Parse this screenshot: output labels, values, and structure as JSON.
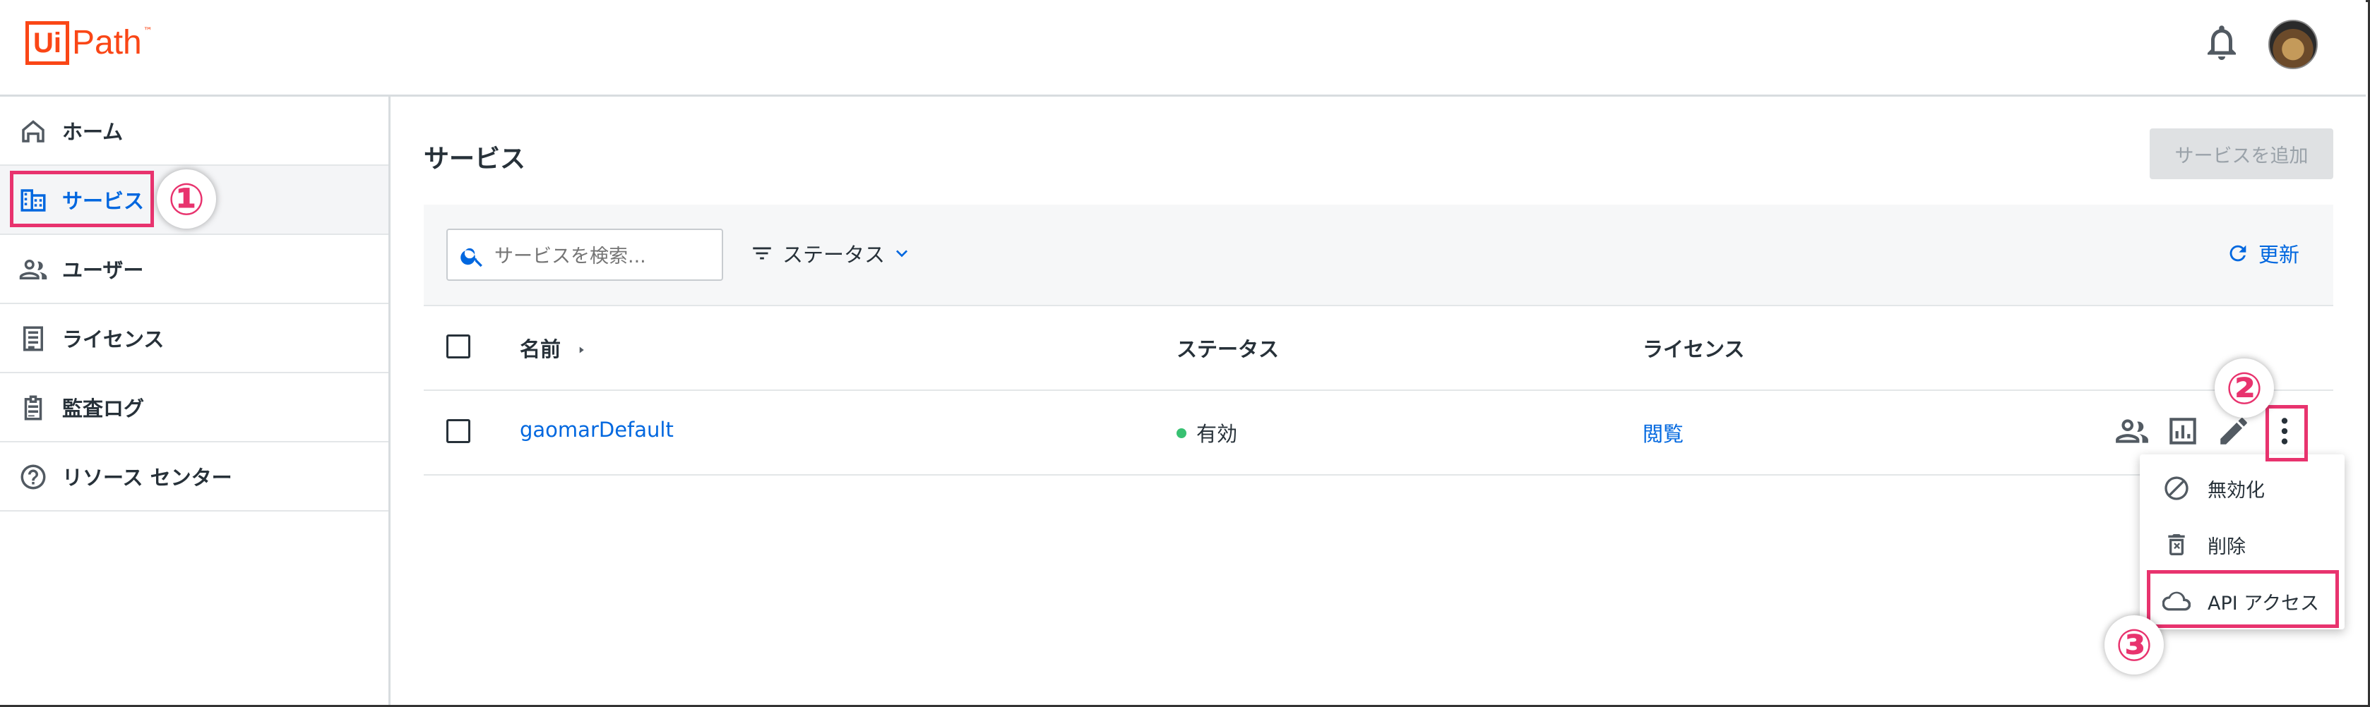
{
  "app": {
    "logo_ui": "Ui",
    "logo_path": "Path",
    "logo_tm": "™"
  },
  "sidebar": {
    "items": [
      {
        "label": "ホーム",
        "icon": "home-icon"
      },
      {
        "label": "サービス",
        "icon": "building-icon",
        "active": true
      },
      {
        "label": "ユーザー",
        "icon": "users-icon"
      },
      {
        "label": "ライセンス",
        "icon": "license-icon"
      },
      {
        "label": "監査ログ",
        "icon": "clipboard-icon"
      },
      {
        "label": "リソース センター",
        "icon": "help-circle-icon"
      }
    ]
  },
  "main": {
    "title": "サービス",
    "add_button": "サービスを追加",
    "search_placeholder": "サービスを検索...",
    "filter_label": "ステータス",
    "refresh_label": "更新",
    "columns": [
      "名前",
      "ステータス",
      "ライセンス"
    ],
    "rows": [
      {
        "name": "gaomarDefault",
        "status": "有効",
        "license": "閲覧"
      }
    ]
  },
  "menu": {
    "items": [
      {
        "label": "無効化",
        "icon": "block-icon"
      },
      {
        "label": "削除",
        "icon": "trash-icon"
      },
      {
        "label": "API アクセス",
        "icon": "cloud-icon"
      }
    ]
  },
  "annotations": {
    "step1": "①",
    "step2": "②",
    "step3": "③"
  },
  "colors": {
    "accent": "#0067df",
    "brand": "#fa4616",
    "highlight": "#e8336e",
    "status_active": "#38c172"
  }
}
